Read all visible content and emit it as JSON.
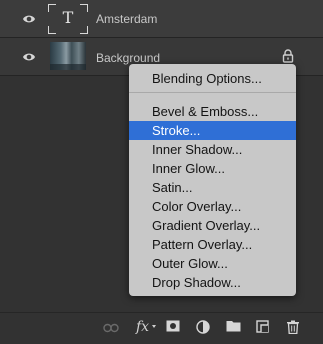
{
  "layers": [
    {
      "name": "Amsterdam",
      "type": "text",
      "thumb_glyph": "T",
      "visibility_icon": "eye-icon"
    },
    {
      "name": "Background",
      "type": "image",
      "visibility_icon": "eye-icon",
      "lock_icon": "lock-icon"
    }
  ],
  "context_menu": {
    "items": [
      {
        "label": "Blending Options..."
      },
      {
        "label": "Bevel & Emboss..."
      },
      {
        "label": "Stroke...",
        "selected": true
      },
      {
        "label": "Inner Shadow..."
      },
      {
        "label": "Inner Glow..."
      },
      {
        "label": "Satin..."
      },
      {
        "label": "Color Overlay..."
      },
      {
        "label": "Gradient Overlay..."
      },
      {
        "label": "Pattern Overlay..."
      },
      {
        "label": "Outer Glow..."
      },
      {
        "label": "Drop Shadow..."
      }
    ],
    "highlight_color": "#2f6fd6"
  },
  "toolbar": {
    "fx_label": "fx",
    "icons": [
      "link-icon",
      "fx-icon",
      "mask-icon",
      "adjustment-icon",
      "folder-icon",
      "new-layer-icon",
      "trash-icon"
    ]
  }
}
